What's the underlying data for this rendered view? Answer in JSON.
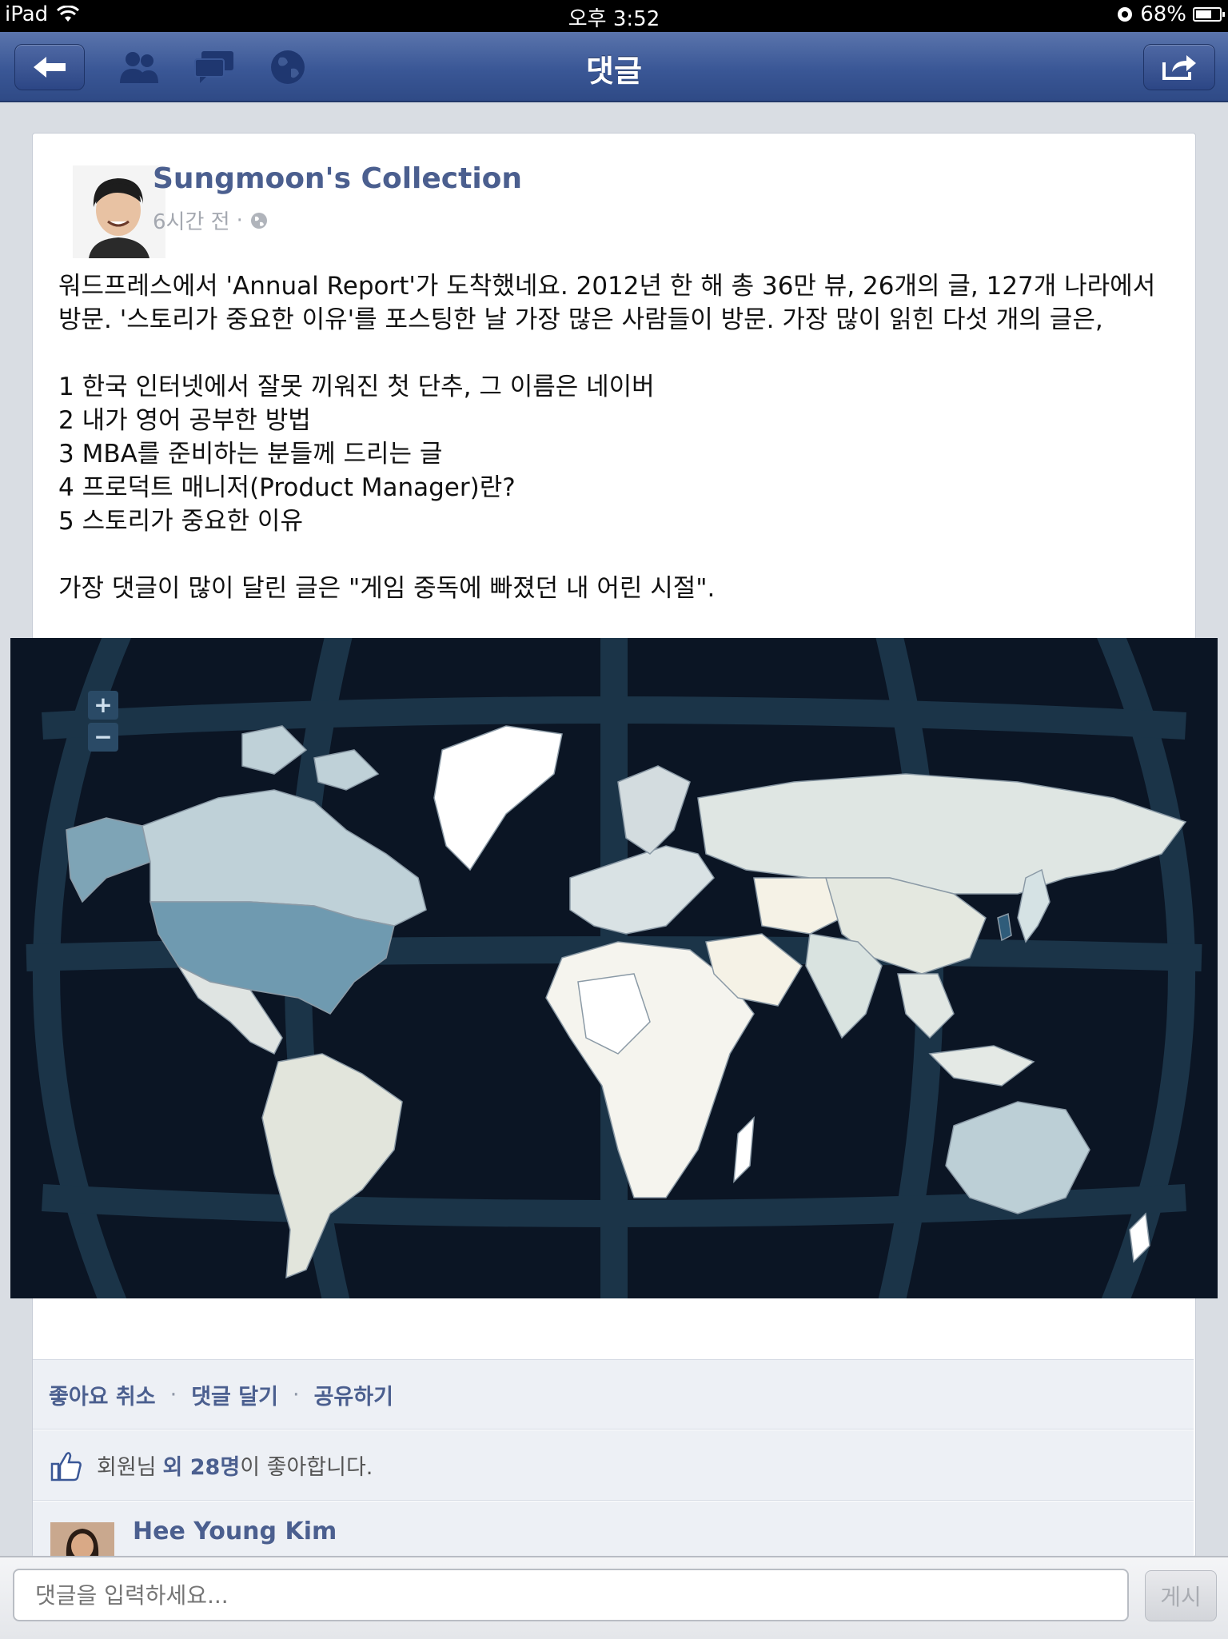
{
  "status_bar": {
    "device": "iPad",
    "time": "오후 3:52",
    "battery": "68%",
    "battery_level": 0.68
  },
  "nav": {
    "title": "댓글"
  },
  "post": {
    "author": "Sungmoon's Collection",
    "time": "6시간 전",
    "separator": "·",
    "body": {
      "intro_line1": "워드프레스에서 'Annual Report'가 도착했네요. 2012년 한 해 총 36만 뷰, 26개의 글, 127개 나라에서",
      "intro_line2": "방문. '스토리가 중요한 이유'를 포스팅한 날 가장 많은 사람들이 방문. 가장 많이 읽힌 다섯 개의 글은,",
      "list": [
        "1 한국 인터넷에서 잘못 끼워진 첫 단추, 그 이름은 네이버",
        "2 내가 영어 공부한 방법",
        "3 MBA를 준비하는 분들께 드리는 글",
        "4 프로덕트 매니저(Product Manager)란?",
        "5 스토리가 중요한 이유"
      ],
      "closing": "가장 댓글이 많이 달린 글은 \"게임 중독에 빠졌던 내 어린 시절\"."
    },
    "map": {
      "zoom_in": "+",
      "zoom_out": "−"
    }
  },
  "actions": {
    "unlike": "좋아요 취소",
    "comment": "댓글 달기",
    "share": "공유하기",
    "dot": "·"
  },
  "likes": {
    "prefix": "회원님",
    "others": "외 28명",
    "suffix": "이 좋아합니다."
  },
  "comment": {
    "author": "Hee Young Kim"
  },
  "input": {
    "placeholder": "댓글을 입력하세요...",
    "post_label": "게시"
  },
  "colors": {
    "nav": "#3a5796",
    "link": "#4b5f8f",
    "map_bg": "#0b1524",
    "highlight_country": "#6f9ab0"
  }
}
